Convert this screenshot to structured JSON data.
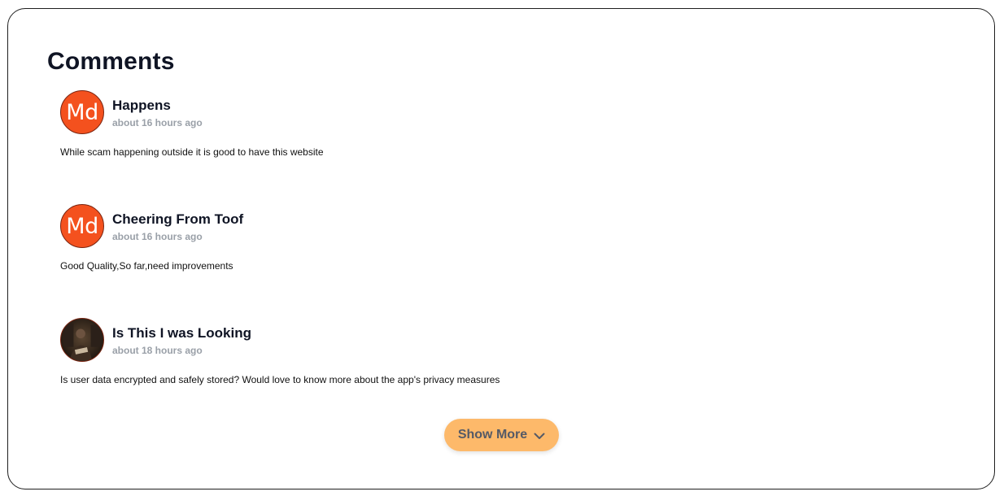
{
  "section": {
    "title": "Comments"
  },
  "comments": [
    {
      "avatar": {
        "type": "initials",
        "initials": "Md",
        "color": "#f4511e"
      },
      "author": "Happens",
      "time": "about 16 hours ago",
      "text": "While scam happening outside it is good to have this website"
    },
    {
      "avatar": {
        "type": "initials",
        "initials": "Md",
        "color": "#f4511e"
      },
      "author": "Cheering From Toof",
      "time": "about 16 hours ago",
      "text": "Good Quality,So far,need improvements"
    },
    {
      "avatar": {
        "type": "photo",
        "color": "#3a2a1e"
      },
      "author": "Is This I was Looking",
      "time": "about 18 hours ago",
      "text": "Is user data encrypted and safely stored? Would love to know more about the app's privacy measures"
    }
  ],
  "show_more": {
    "label": "Show More",
    "icon": "chevron-down-icon",
    "color": "#fdb96a"
  }
}
